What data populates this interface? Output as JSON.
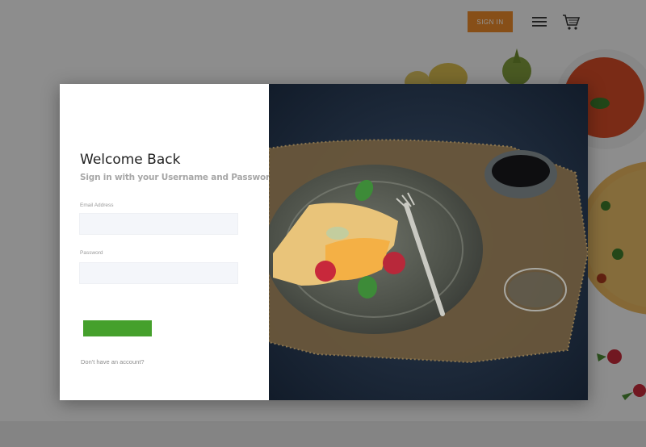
{
  "header": {
    "signin_label": "SIGN IN",
    "menu_icon": "hamburger-menu-icon",
    "cart_icon": "shopping-cart-icon"
  },
  "modal": {
    "title": "Welcome Back",
    "subtitle": "Sign in with your Username and Password",
    "email_label": "Email Address",
    "email_value": "",
    "password_label": "Password",
    "password_value": "",
    "submit_label": "",
    "signup_text": "Don't have an account?"
  },
  "colors": {
    "accent_orange": "#e8892a",
    "submit_green": "#45a02c",
    "overlay": "rgba(0,0,0,0.42)"
  }
}
